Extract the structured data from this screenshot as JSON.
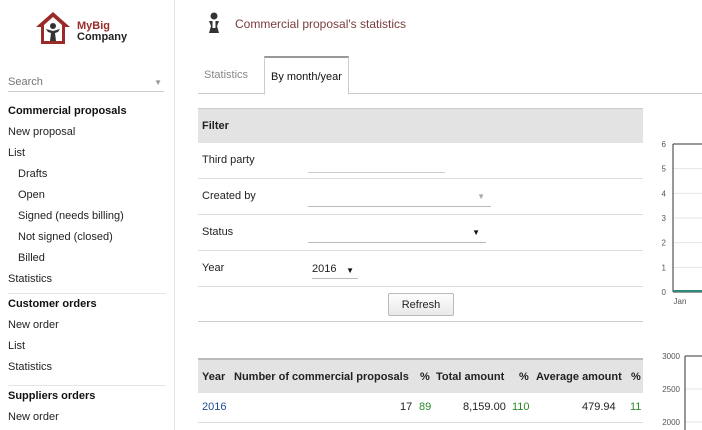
{
  "sidebar": {
    "logo": {
      "line1": "MyBig",
      "line2": "Company"
    },
    "search_placeholder": "Search",
    "sections": [
      {
        "title": "Commercial proposals",
        "items": [
          {
            "label": "New proposal",
            "sub": false
          },
          {
            "label": "List",
            "sub": false
          },
          {
            "label": "Drafts",
            "sub": true
          },
          {
            "label": "Open",
            "sub": true
          },
          {
            "label": "Signed (needs billing)",
            "sub": true
          },
          {
            "label": "Not signed (closed)",
            "sub": true
          },
          {
            "label": "Billed",
            "sub": true
          },
          {
            "label": "Statistics",
            "sub": false
          }
        ]
      },
      {
        "title": "Customer orders",
        "items": [
          {
            "label": "New order",
            "sub": false
          },
          {
            "label": "List",
            "sub": false
          },
          {
            "label": "Statistics",
            "sub": false
          }
        ]
      },
      {
        "title": "Suppliers orders",
        "items": [
          {
            "label": "New order",
            "sub": false
          }
        ]
      }
    ]
  },
  "header": {
    "title": "Commercial proposal's statistics"
  },
  "tabs": [
    {
      "label": "Statistics",
      "active": false
    },
    {
      "label": "By month/year",
      "active": true
    }
  ],
  "filter": {
    "heading": "Filter",
    "third_party_label": "Third party",
    "third_party_value": "",
    "created_by_label": "Created by",
    "status_label": "Status",
    "year_label": "Year",
    "year_value": "2016",
    "refresh_label": "Refresh"
  },
  "stats_table": {
    "headers": [
      "Year",
      "Number of commercial proposals",
      "%",
      "Total amount",
      "%",
      "Average amount",
      "%"
    ],
    "rows": [
      {
        "year": "2016",
        "count": "17",
        "count_pct": "89",
        "total": "8,159.00",
        "total_pct": "110",
        "avg": "479.94",
        "avg_pct": "11"
      }
    ]
  },
  "chart_data": [
    {
      "type": "line",
      "y_ticks": [
        "0",
        "1",
        "2",
        "3",
        "4",
        "5",
        "6"
      ],
      "x_ticks": [
        "Jan"
      ],
      "ylim": [
        0,
        6
      ]
    },
    {
      "type": "line",
      "y_ticks": [
        "2000",
        "2500",
        "3000"
      ],
      "ylim": [
        1500,
        3000
      ]
    }
  ],
  "colors": {
    "title_accent": "#7a3c3c",
    "link": "#1f4e8c",
    "positive_pct": "#2a8a2a",
    "series1": "#2e8b7a"
  }
}
